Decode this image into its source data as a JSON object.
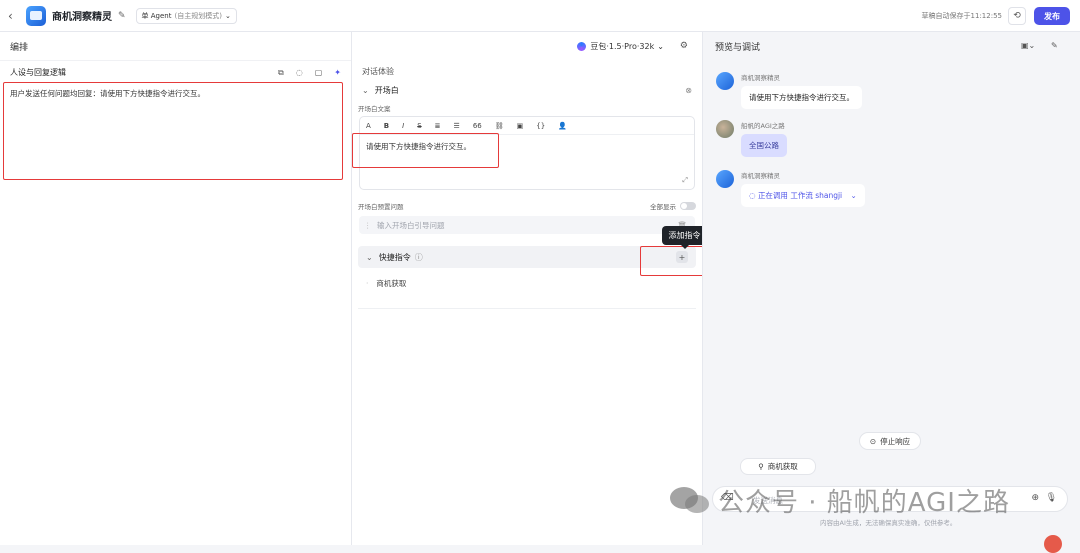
{
  "topbar": {
    "title": "商机洞察精灵",
    "mode_label": "单 Agent",
    "mode_sub": "(自主规划模式)",
    "saved_text": "草稿自动保存于11:12:55",
    "publish_label": "发布"
  },
  "left": {
    "section_label": "编排",
    "persona_title": "人设与回复逻辑",
    "persona_text": "用户发送任何问题均回复：请使用下方快捷指令进行交互。"
  },
  "model": {
    "name": "豆包·1.5·Pro·32k"
  },
  "mid": {
    "section": "对话体验",
    "opening_title": "开场白",
    "opening_text_label": "开场白文案",
    "toolbar": [
      "A",
      "B",
      "I",
      "S",
      "≣",
      "☰",
      "66",
      "⛓",
      "▣",
      "{}",
      "👤"
    ],
    "opening_text": "请使用下方快捷指令进行交互。",
    "preset_label": "开场白预置问题",
    "show_all_label": "全部显示",
    "preset_placeholder": "输入开场白引导问题",
    "shortcut_title": "快捷指令",
    "shortcut_item": "商机获取",
    "tooltip": "添加指令"
  },
  "right": {
    "title": "预览与调试",
    "messages": [
      {
        "name": "商机洞察精灵",
        "text": "请使用下方快捷指令进行交互。"
      },
      {
        "name": "船帆的AGI之路",
        "text": "全国公路"
      },
      {
        "name": "商机洞察精灵",
        "text": "正在调用 工作流 shangji"
      }
    ],
    "stop_label": "停止响应",
    "chip_label": "商机获取",
    "input_placeholder": "发送消息",
    "disclaimer": "内容由AI生成，无法确保真实准确，仅供参考。"
  },
  "watermark": "公众号 · 船帆的AGI之路",
  "colors": {
    "accent": "#4d53e8",
    "highlight": "#e53a3a"
  }
}
